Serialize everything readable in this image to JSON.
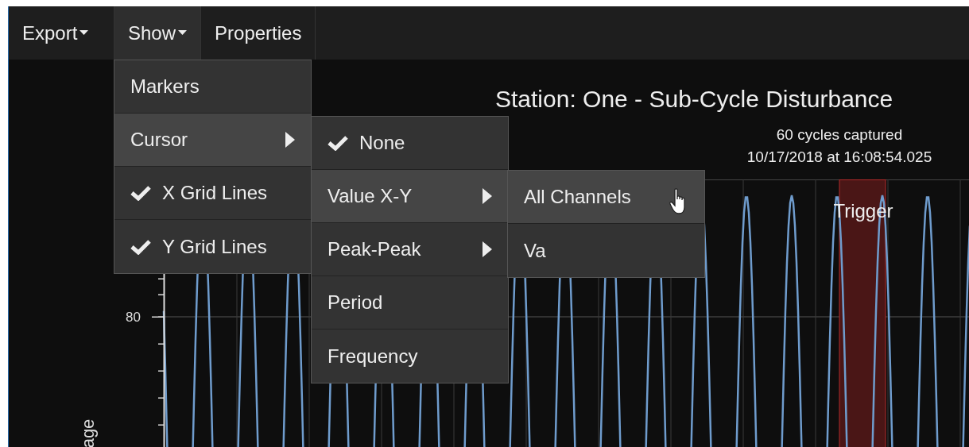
{
  "toolbar": [
    {
      "label": "Export",
      "has_caret": true,
      "selected": false
    },
    {
      "label": "Show",
      "has_caret": true,
      "selected": true
    },
    {
      "label": "Properties",
      "has_caret": false,
      "selected": false
    }
  ],
  "show_menu": [
    {
      "label": "Markers",
      "checked": false,
      "submenu": false,
      "selected": false
    },
    {
      "label": "Cursor",
      "checked": false,
      "submenu": true,
      "selected": true
    },
    {
      "label": "X Grid Lines",
      "checked": true,
      "submenu": false,
      "selected": false
    },
    {
      "label": "Y Grid Lines",
      "checked": true,
      "submenu": false,
      "selected": false
    }
  ],
  "cursor_menu": [
    {
      "label": "None",
      "checked": true,
      "submenu": false,
      "selected": false
    },
    {
      "label": "Value X-Y",
      "checked": false,
      "submenu": true,
      "selected": true
    },
    {
      "label": "Peak-Peak",
      "checked": false,
      "submenu": true,
      "selected": false
    },
    {
      "label": "Period",
      "checked": false,
      "submenu": false,
      "selected": false
    },
    {
      "label": "Frequency",
      "checked": false,
      "submenu": false,
      "selected": false
    }
  ],
  "value_menu": [
    {
      "label": "All Channels",
      "checked": false,
      "submenu": false,
      "selected": true
    },
    {
      "label": "Va",
      "checked": false,
      "submenu": false,
      "selected": false
    }
  ],
  "chart": {
    "title": "Station: One - Sub-Cycle Disturbance",
    "subtitle_lines": [
      "60 cycles captured",
      "10/17/2018 at 16:08:54.025"
    ],
    "trigger_label": "Trigger",
    "y_tick": "80",
    "y_axis_label": "age"
  }
}
